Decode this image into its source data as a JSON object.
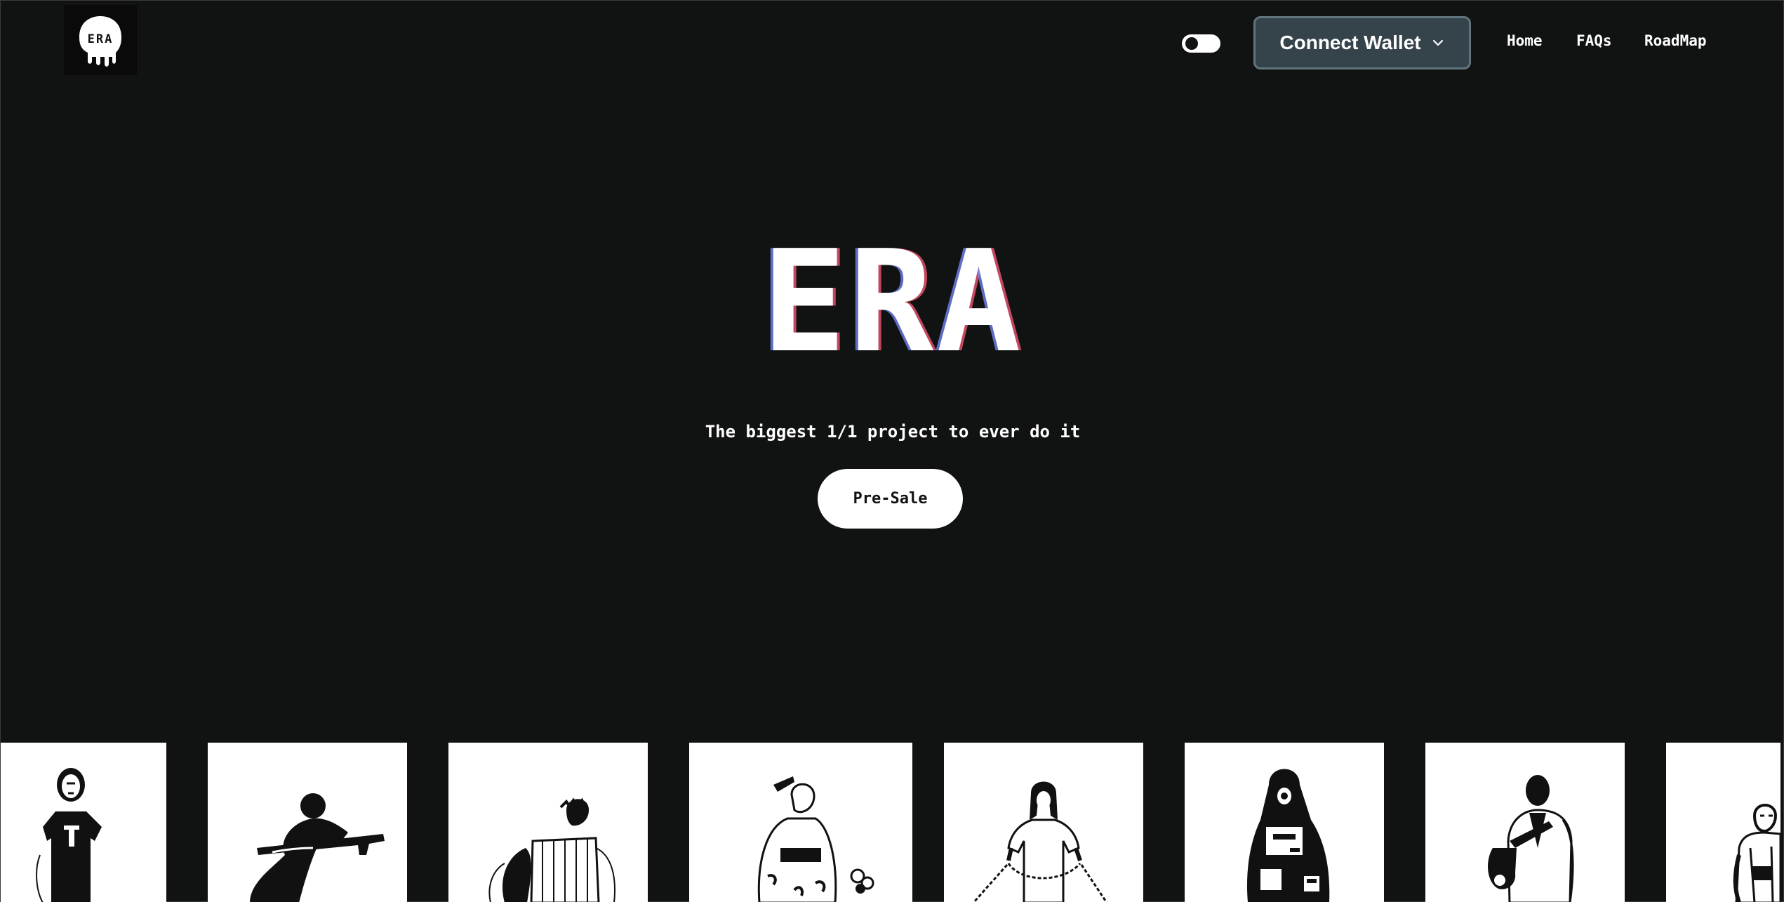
{
  "header": {
    "logo": {
      "text": "ERA",
      "icon": "skull-logo-icon"
    },
    "theme_toggle": {
      "state": "off"
    },
    "wallet_button": {
      "label": "Connect Wallet",
      "icon": "chevron-down-icon"
    },
    "nav": [
      {
        "label": "Home"
      },
      {
        "label": "FAQs"
      },
      {
        "label": "RoadMap"
      }
    ]
  },
  "hero": {
    "title": "ERA",
    "tagline": "The biggest 1/1 project to ever do it",
    "cta_label": "Pre-Sale"
  },
  "gallery": {
    "items": [
      {
        "subject": "person-tshirt-illustration"
      },
      {
        "subject": "soldier-rifle-illustration"
      },
      {
        "subject": "person-crate-illustration"
      },
      {
        "subject": "kimono-woman-illustration"
      },
      {
        "subject": "woman-chain-illustration"
      },
      {
        "subject": "hooded-figure-illustration"
      },
      {
        "subject": "saxophone-player-illustration"
      },
      {
        "subject": "person-overalls-illustration"
      }
    ]
  },
  "colors": {
    "background": "#111312",
    "wallet_button_bg": "#35434a",
    "wallet_button_border": "#5f747c",
    "text": "#ffffff"
  }
}
